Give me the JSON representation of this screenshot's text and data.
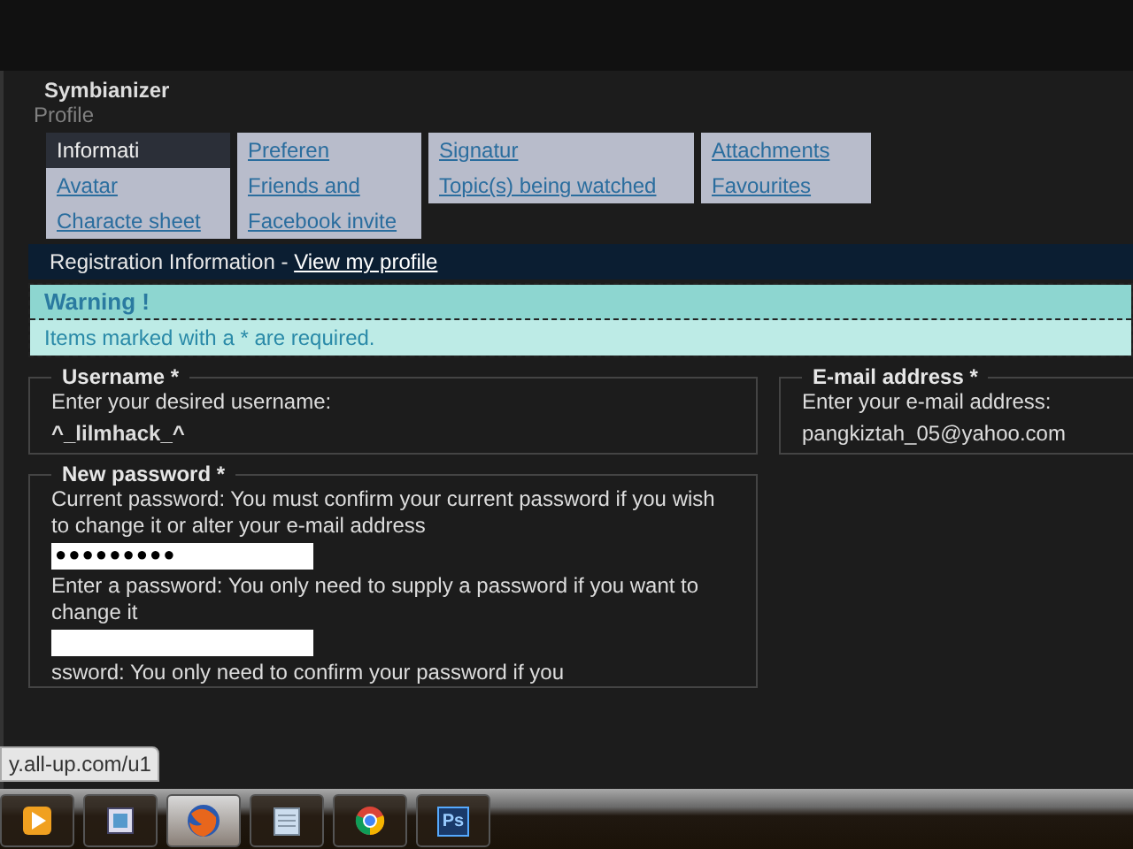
{
  "site": {
    "title": "Symbianizer",
    "subtitle": "Profile"
  },
  "tabs": [
    {
      "label": "Informati",
      "selected": true
    },
    {
      "label": "Preferen",
      "selected": false
    },
    {
      "label": "Signatur",
      "selected": false
    },
    {
      "label": "Attachments",
      "selected": false
    },
    {
      "label": "Avatar",
      "selected": false
    },
    {
      "label": "Friends and",
      "selected": false
    },
    {
      "label": "Topic(s) being watched",
      "selected": false
    },
    {
      "label": "Favourites",
      "selected": false
    },
    {
      "label": "Characte sheet",
      "selected": false
    },
    {
      "label": "Facebook invite",
      "selected": false
    }
  ],
  "section_header": {
    "title": "Registration Information - ",
    "link": "View my profile"
  },
  "warning": {
    "title": "Warning !",
    "message": "Items marked with a * are required."
  },
  "username": {
    "legend": "Username *",
    "hint": "Enter your desired username:",
    "value": "^_lilmhack_^"
  },
  "email": {
    "legend": "E-mail address *",
    "hint": "Enter your e-mail address:",
    "value": "pangkiztah_05@yahoo.com"
  },
  "password": {
    "legend": "New password *",
    "current_hint": "Current password: You must confirm your current password if you wish to change it or alter your e-mail address",
    "current_value": "●●●●●●●●●",
    "new_hint": "Enter a password: You only need to supply a password if you want to change it",
    "confirm_hint": "ssword: You only need to confirm your password if you"
  },
  "status_url": "y.all-up.com/u1",
  "taskbar": [
    {
      "kind": "media",
      "selected": false
    },
    {
      "kind": "app",
      "selected": false
    },
    {
      "kind": "firefox",
      "selected": true
    },
    {
      "kind": "notepad",
      "selected": false
    },
    {
      "kind": "chrome",
      "selected": false
    },
    {
      "kind": "photoshop",
      "selected": false,
      "label": "Ps"
    }
  ]
}
